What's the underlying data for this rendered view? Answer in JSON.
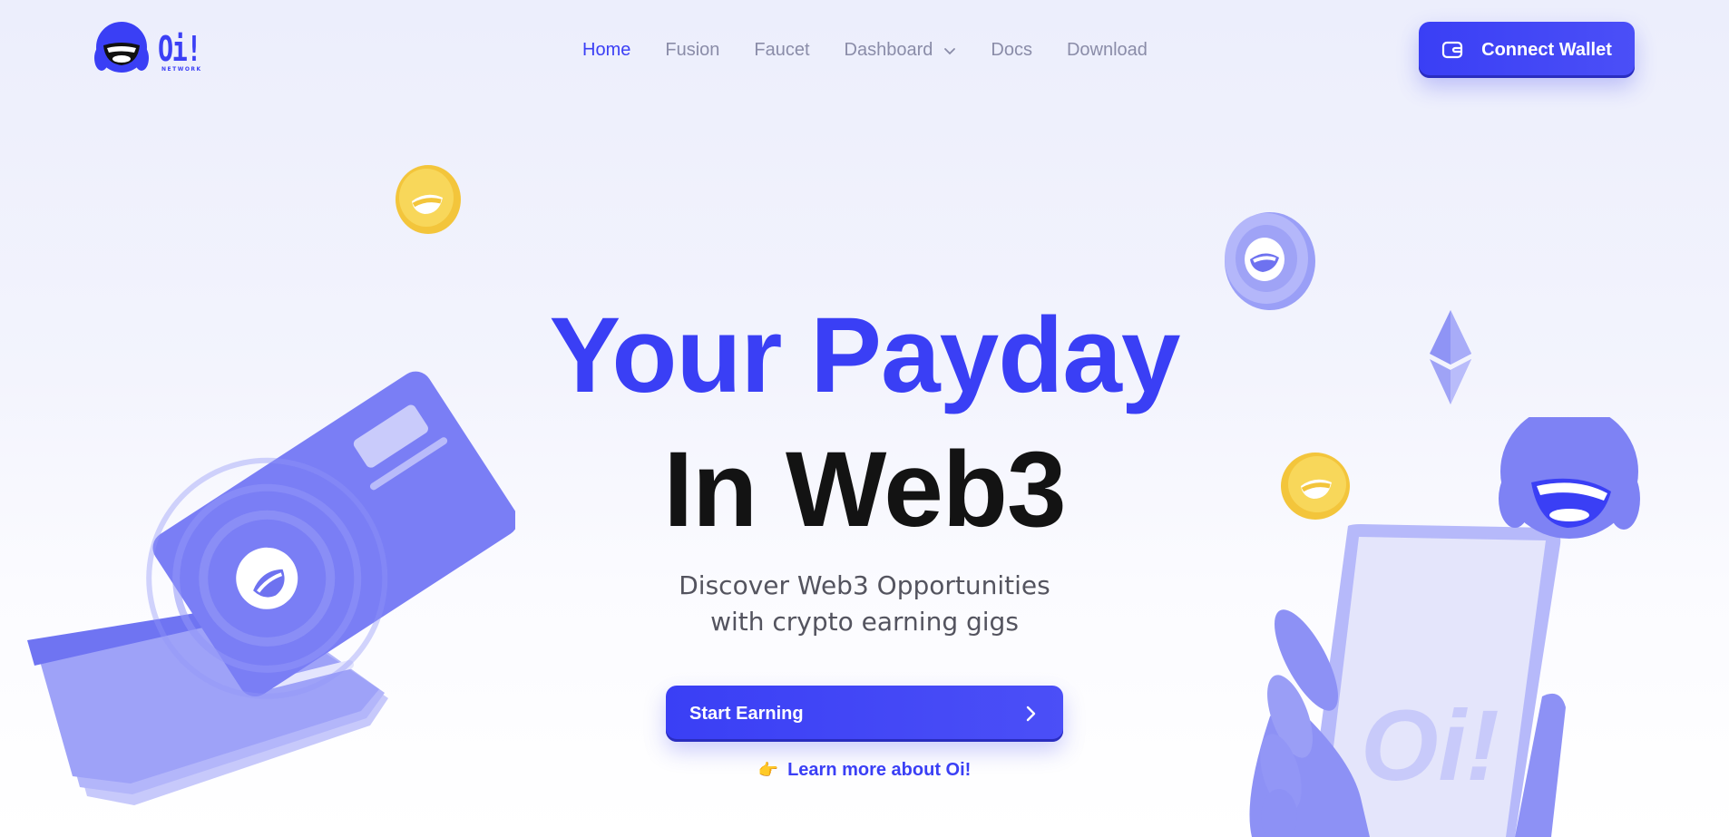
{
  "brand": {
    "wordmark": "Oi!",
    "sub": "NETWORK",
    "accent": "#3a3ff5",
    "dark": "#131313"
  },
  "nav": {
    "items": [
      {
        "label": "Home",
        "active": true
      },
      {
        "label": "Fusion"
      },
      {
        "label": "Faucet"
      },
      {
        "label": "Dashboard",
        "dropdown": true
      },
      {
        "label": "Docs"
      },
      {
        "label": "Download"
      }
    ],
    "connect_label": "Connect Wallet"
  },
  "hero": {
    "line1": "Your Payday",
    "line2": "In Web3",
    "sub_line1": "Discover Web3 Opportunities",
    "sub_line2": "with crypto earning gigs",
    "cta": "Start Earning",
    "learn_more": "Learn more about Oi!",
    "learn_icon": "👉"
  },
  "icons": {
    "wallet": "wallet-icon",
    "chevron": "chevron-down-icon",
    "arrow": "chevron-right-icon"
  }
}
